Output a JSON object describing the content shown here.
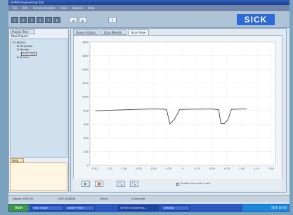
{
  "window": {
    "title": "SOPAS Engineering Tool"
  },
  "menu": [
    "File",
    "Edit",
    "Communication",
    "View",
    "Options",
    "Help"
  ],
  "toolbar": {
    "buttons": [
      "1",
      "2",
      "3",
      "4",
      "5",
      "6"
    ],
    "nav": [
      "◄",
      "►"
    ],
    "extra": "?"
  },
  "brand": {
    "logo": "SICK",
    "color": "#2d6ad8"
  },
  "left_panel": {
    "tab": "Project Tree",
    "subtitle": "New Project",
    "tree": [
      {
        "label": "LMS100",
        "indent": 0
      },
      {
        "label": "Parameter",
        "indent": 1
      },
      {
        "label": "Monitor",
        "indent": 1
      },
      {
        "label": "Scan View",
        "indent": 2
      },
      {
        "label": "Service",
        "indent": 1
      }
    ],
    "help_tab": "Help"
  },
  "tabs": [
    {
      "label": "Device Status",
      "active": false
    },
    {
      "label": "Scan Monitor",
      "active": false
    },
    {
      "label": "Scan View",
      "active": true
    }
  ],
  "chart_data": {
    "type": "line",
    "x": [
      -1.5,
      -1.1,
      -0.8,
      -0.5,
      -0.35,
      -0.28,
      -0.22,
      -0.15,
      -0.05,
      0.1,
      0.3,
      0.5,
      0.62,
      0.66,
      0.72,
      0.78,
      0.84,
      0.95,
      1.1
    ],
    "series": [
      {
        "values": [
          840,
          852,
          862,
          868,
          866,
          860,
          640,
          700,
          860,
          864,
          866,
          868,
          858,
          640,
          645,
          700,
          862,
          866,
          868
        ]
      }
    ],
    "xticks": [
      "-1.50",
      "-1.25",
      "-1.00",
      "-0.75",
      "-0.50",
      "-0.25",
      "0",
      "0.25",
      "0.50",
      "0.75",
      "1.00",
      "1.25",
      "1.50"
    ],
    "yticks": [
      "1800",
      "1600",
      "1400",
      "1200",
      "1000",
      "800",
      "600",
      "400",
      "200",
      "0"
    ],
    "xlim": [
      -1.6,
      1.6
    ],
    "ylim": [
      0,
      1900
    ],
    "grid": true,
    "line_color": "#444444"
  },
  "bottom": {
    "buttons": [
      "▶",
      "■",
      "🔍",
      "🔍"
    ],
    "checkbox_label": "Enable free scale Y axis"
  },
  "status": [
    "Device: LMS100",
    "COM: USB/Eth",
    "Online",
    "Connected"
  ],
  "taskbar": {
    "start": "Start",
    "tasks": [
      {
        "label": "Total Image",
        "active": false
      },
      {
        "label": "Adobe Photo",
        "active": false
      },
      {
        "label": "SOPAS Engineering...",
        "active": true
      },
      {
        "label": "Desktop",
        "active": false
      }
    ],
    "tray": "SICK 10:44"
  }
}
